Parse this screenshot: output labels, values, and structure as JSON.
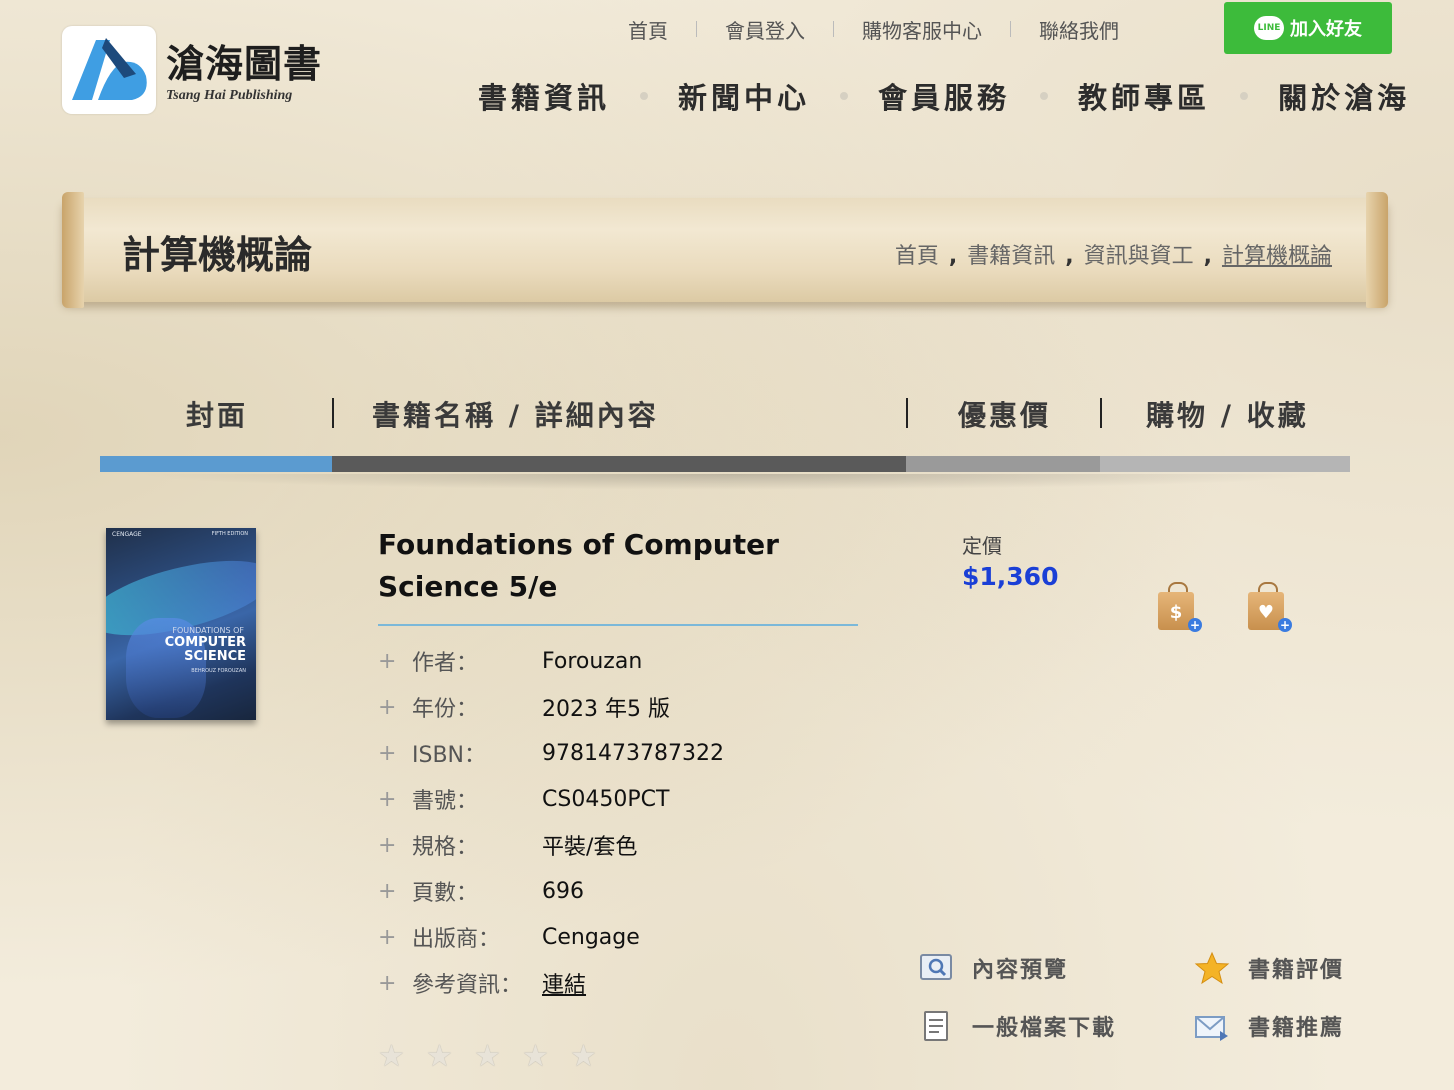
{
  "logo": {
    "name": "滄海圖書",
    "subtitle": "Tsang Hai Publishing"
  },
  "toplinks": [
    "首頁",
    "會員登入",
    "購物客服中心",
    "聯絡我們"
  ],
  "line_button": {
    "icon_text": "LINE",
    "label": "加入好友"
  },
  "main_nav": [
    "書籍資訊",
    "新聞中心",
    "會員服務",
    "教師專區",
    "關於滄海"
  ],
  "page_title": "計算機概論",
  "breadcrumb": [
    "首頁",
    "書籍資訊",
    "資訊與資工",
    "計算機概論"
  ],
  "breadcrumb_separator": ",",
  "table_header": {
    "cover": "封面",
    "name": "書籍名稱 / 詳細內容",
    "price": "優惠價",
    "shop": "購物 / 收藏"
  },
  "tab_colors": [
    "#5b9bd0",
    "#5a5a5a",
    "#9a9a9a",
    "#b5b5b5"
  ],
  "book": {
    "cover_text": {
      "publisher": "CENGAGE",
      "edition": "FIFTH EDITION",
      "small": "FOUNDATIONS OF",
      "big": "COMPUTER SCIENCE",
      "author": "BEHROUZ FOROUZAN"
    },
    "title": "Foundations of Computer Science 5/e",
    "details": [
      {
        "label": "作者：",
        "value": "Forouzan"
      },
      {
        "label": "年份：",
        "value": "2023 年5 版"
      },
      {
        "label": "ISBN：",
        "value": "9781473787322"
      },
      {
        "label": "書號：",
        "value": "CS0450PCT"
      },
      {
        "label": "規格：",
        "value": "平裝/套色"
      },
      {
        "label": "頁數：",
        "value": "696"
      },
      {
        "label": "出版商：",
        "value": "Cengage"
      },
      {
        "label": "參考資訊：",
        "value": "連結"
      }
    ],
    "price_label": "定價",
    "price": "$1,360",
    "rating_stars": 5,
    "rating_filled": 0
  },
  "icons": {
    "cart": "shopping-bag-dollar-icon",
    "favorite": "shopping-bag-heart-icon"
  },
  "tools": {
    "preview": "內容預覽",
    "review": "書籍評價",
    "download": "一般檔案下載",
    "recommend": "書籍推薦"
  }
}
